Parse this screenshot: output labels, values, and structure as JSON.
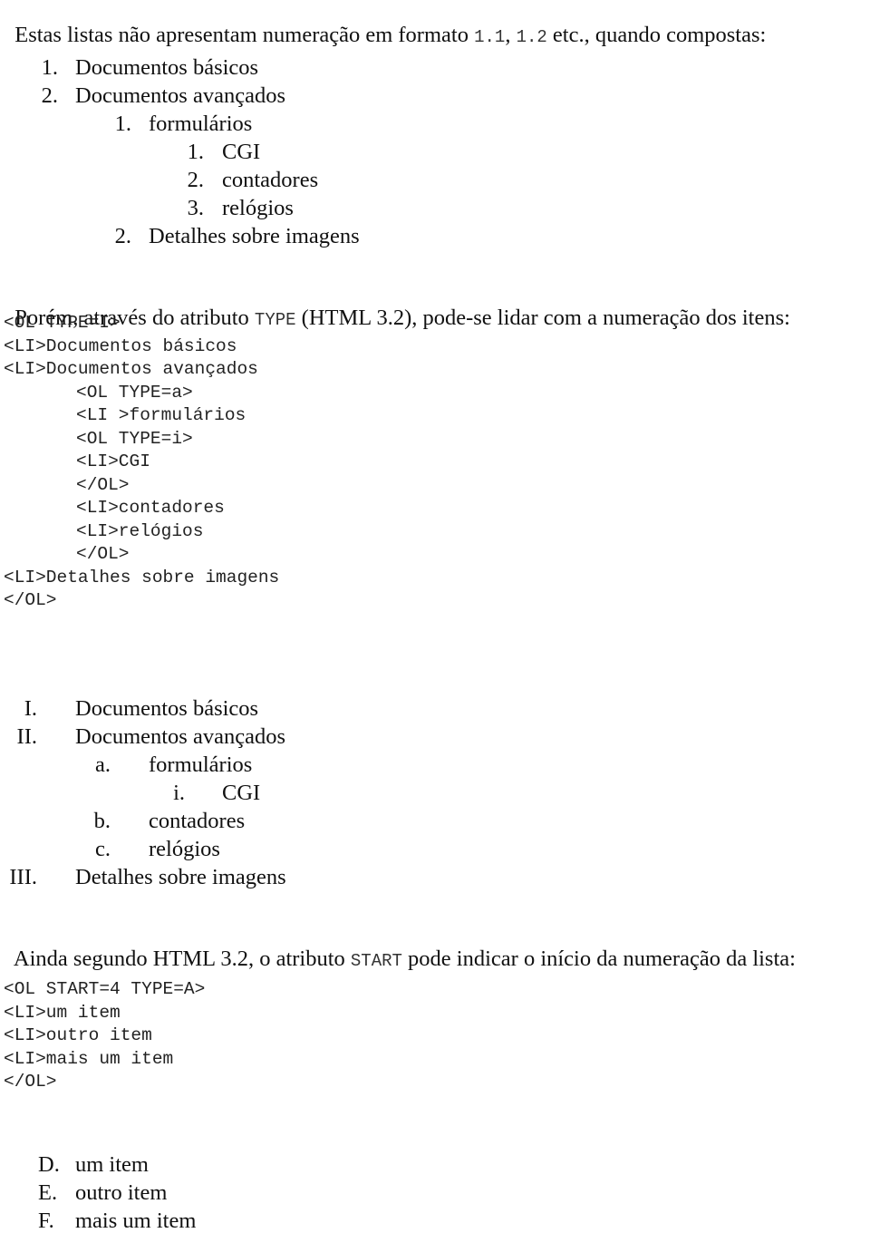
{
  "intro": {
    "text_before": "Estas listas não apresentam numeração em formato ",
    "code1": "1.1",
    "comma": ", ",
    "code2": "1.2",
    "text_after": " etc., quando compostas:"
  },
  "list1": [
    {
      "marker": "1.",
      "text": "Documentos básicos",
      "level": 0
    },
    {
      "marker": "2.",
      "text": "Documentos avançados",
      "level": 0
    },
    {
      "marker": "1.",
      "text": "formulários",
      "level": 1
    },
    {
      "marker": "1.",
      "text": "CGI",
      "level": 2
    },
    {
      "marker": "2.",
      "text": "contadores",
      "level": 2
    },
    {
      "marker": "3.",
      "text": "relógios",
      "level": 2
    },
    {
      "marker": "2.",
      "text": "Detalhes sobre imagens",
      "level": 1
    }
  ],
  "para2": {
    "text_before": "Porém, através do atributo ",
    "code": "TYPE",
    "text_after": " (HTML 3.2), pode-se lidar com a numeração dos itens:"
  },
  "code1": [
    {
      "text": "<OL TYPE=I>",
      "indent": 0
    },
    {
      "text": "<LI>Documentos básicos",
      "indent": 0
    },
    {
      "text": "<LI>Documentos avançados",
      "indent": 0
    },
    {
      "text": "<OL TYPE=a>",
      "indent": 1
    },
    {
      "text": "<LI >formulários",
      "indent": 1
    },
    {
      "text": "<OL TYPE=i>",
      "indent": 1
    },
    {
      "text": "<LI>CGI",
      "indent": 1
    },
    {
      "text": "</OL>",
      "indent": 1
    },
    {
      "text": "<LI>contadores",
      "indent": 1
    },
    {
      "text": "<LI>relógios",
      "indent": 1
    },
    {
      "text": "</OL>",
      "indent": 1
    },
    {
      "text": "<LI>Detalhes sobre imagens",
      "indent": 0
    },
    {
      "text": "</OL>",
      "indent": 0
    }
  ],
  "list2": [
    {
      "marker": "I.",
      "text": "Documentos básicos",
      "level": 0
    },
    {
      "marker": "II.",
      "text": "Documentos avançados",
      "level": 0
    },
    {
      "marker": "a.",
      "text": "formulários",
      "level": 1
    },
    {
      "marker": "i.",
      "text": "CGI",
      "level": 2
    },
    {
      "marker": "b.",
      "text": "contadores",
      "level": 1
    },
    {
      "marker": "c.",
      "text": "relógios",
      "level": 1
    },
    {
      "marker": "III.",
      "text": "Detalhes sobre imagens",
      "level": 0
    }
  ],
  "para3": {
    "text_before": "Ainda segundo HTML 3.2, o atributo ",
    "code": "START",
    "text_after": " pode indicar o início da numeração da lista:"
  },
  "code2": [
    {
      "text": "<OL START=4 TYPE=A>"
    },
    {
      "text": "<LI>um item"
    },
    {
      "text": "<LI>outro item"
    },
    {
      "text": "<LI>mais um item"
    },
    {
      "text": "</OL>"
    }
  ],
  "list3": [
    {
      "marker": "D.",
      "text": "um item"
    },
    {
      "marker": "E.",
      "text": "outro item"
    },
    {
      "marker": "F.",
      "text": "mais um item"
    }
  ]
}
